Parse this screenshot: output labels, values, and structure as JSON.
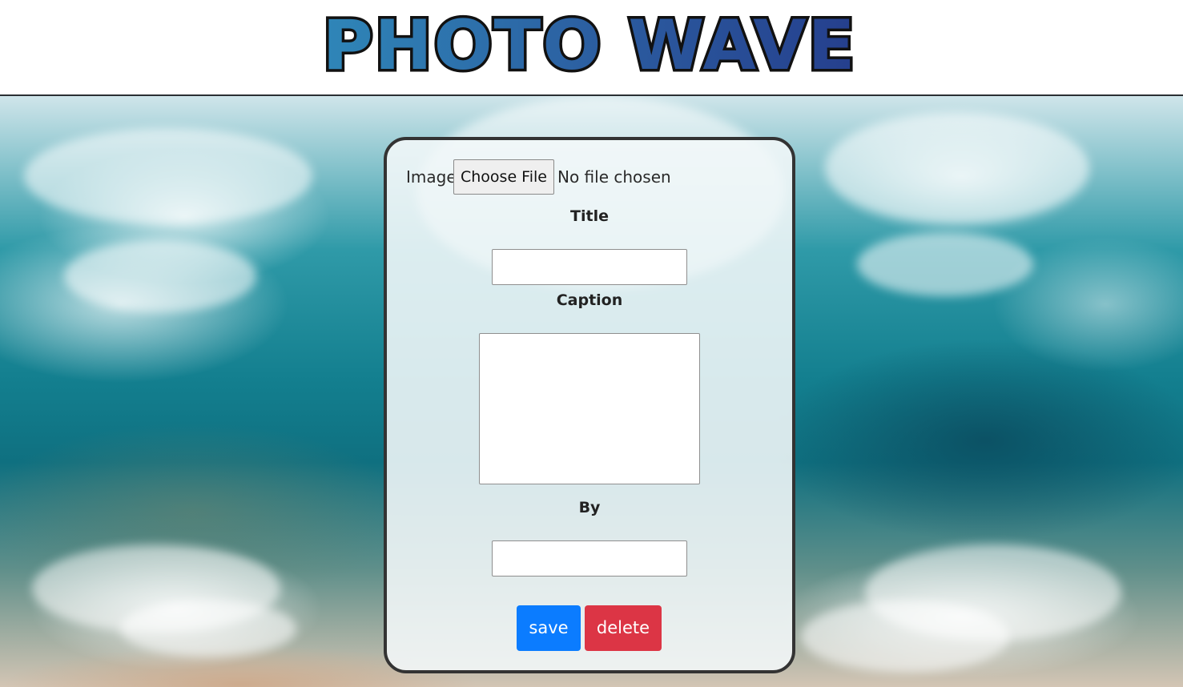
{
  "header": {
    "logo_text": "PHOTO WAVE"
  },
  "form": {
    "image_label": "Image",
    "choose_file_label": "Choose File",
    "file_status": "No file chosen",
    "title_label": "Title",
    "title_value": "",
    "caption_label": "Caption",
    "caption_value": "",
    "by_label": "By",
    "by_value": "",
    "save_label": "save",
    "delete_label": "delete"
  },
  "colors": {
    "save_button": "#0b7cff",
    "delete_button": "#dc3545",
    "logo_gradient_start": "#2f86b8",
    "logo_gradient_end": "#253f8d"
  }
}
